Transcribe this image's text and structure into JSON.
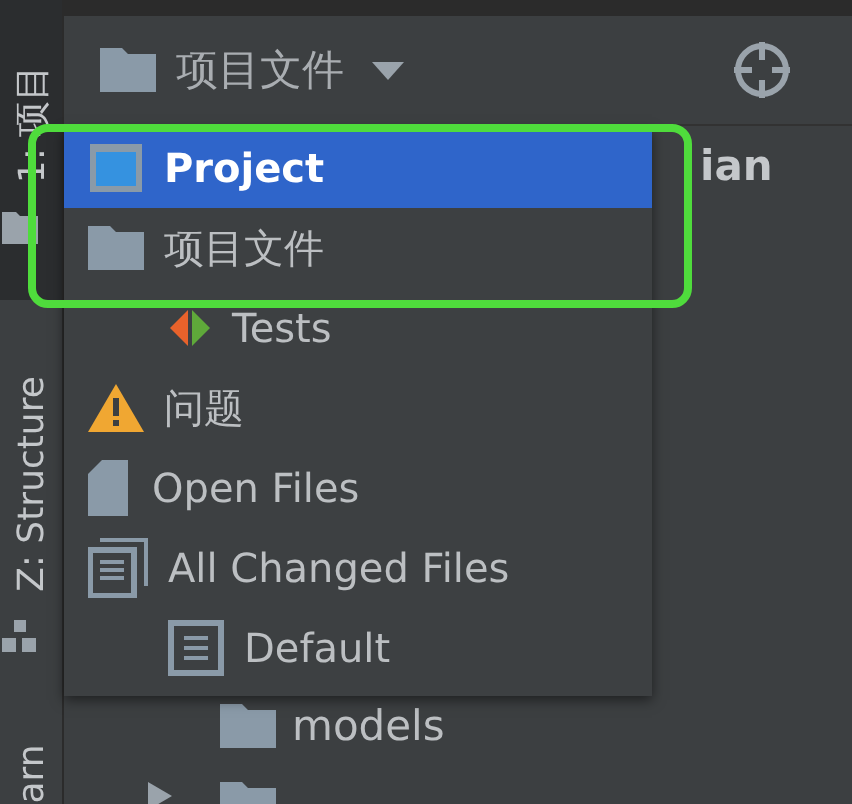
{
  "sidebar_tabs": [
    {
      "label": "1: 项目",
      "selected": true
    },
    {
      "label": "Z: Structure",
      "selected": false
    },
    {
      "label": "arn",
      "selected": false
    }
  ],
  "toolbar": {
    "view_label": "项目文件"
  },
  "tree": {
    "cut_label": "ian",
    "rows": [
      {
        "label": "models"
      }
    ]
  },
  "popup": {
    "items": [
      {
        "label": "Project",
        "kind": "project",
        "selected": true
      },
      {
        "label": "项目文件",
        "kind": "folder",
        "selected": false,
        "children": [
          {
            "label": "Tests",
            "kind": "tests",
            "selected": false
          }
        ]
      },
      {
        "label": "问题",
        "kind": "warning",
        "selected": false
      },
      {
        "label": "Open Files",
        "kind": "file",
        "selected": false
      },
      {
        "label": "All Changed Files",
        "kind": "changes",
        "selected": false,
        "children": [
          {
            "label": "Default",
            "kind": "changelist",
            "selected": false
          }
        ]
      }
    ]
  }
}
